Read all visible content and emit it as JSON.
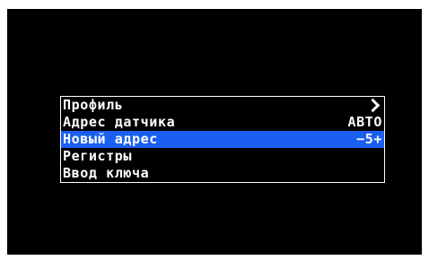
{
  "colors": {
    "screen_background": "#000000",
    "text": "#ffffff",
    "selection": "#1a5ff0",
    "border": "#ffffff"
  },
  "menu": {
    "items": [
      {
        "label": "Профиль",
        "value": "",
        "icon": "chevron-right-icon",
        "selected": false
      },
      {
        "label": "Адрес датчика",
        "value": "АВТО",
        "selected": false
      },
      {
        "label": "Новый адрес",
        "value": "−5+",
        "selected": true
      },
      {
        "label": "Регистры",
        "value": "",
        "selected": false
      },
      {
        "label": "Ввод ключа",
        "value": "",
        "selected": false
      }
    ]
  }
}
